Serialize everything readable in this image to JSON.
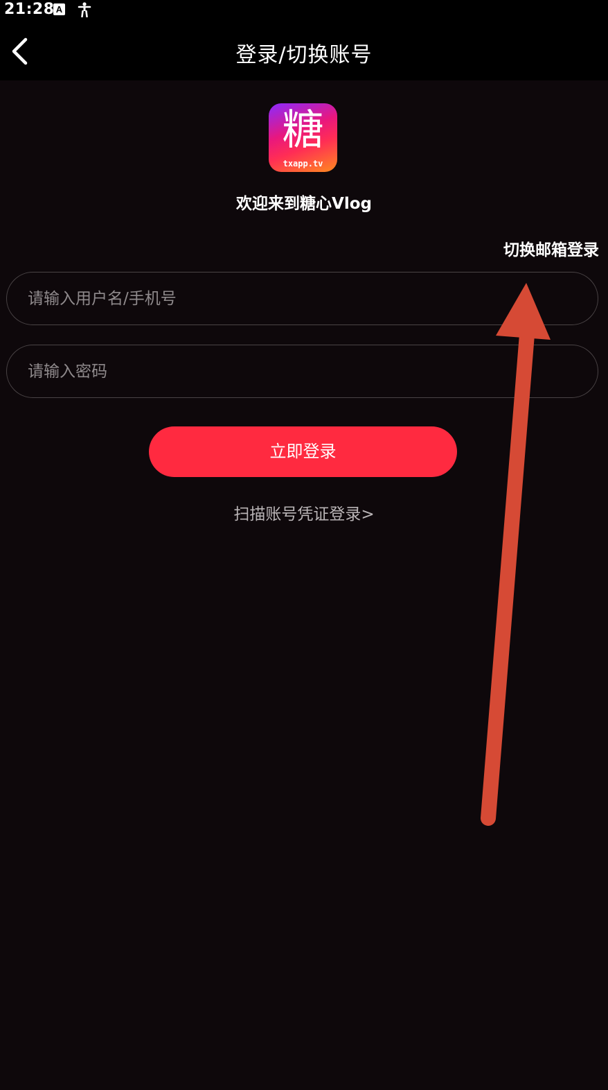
{
  "status_bar": {
    "time": "21:28",
    "icons": [
      "a-notification-icon",
      "accessibility-icon"
    ]
  },
  "header": {
    "title": "登录/切换账号",
    "back_icon": "chevron-left-icon"
  },
  "logo": {
    "char": "糖",
    "url": "txapp.tv"
  },
  "welcome": "欢迎来到糖心Vlog",
  "switch_email": "切换邮箱登录",
  "form": {
    "username_placeholder": "请输入用户名/手机号",
    "password_placeholder": "请输入密码",
    "login_button": "立即登录",
    "scan_login": "扫描账号凭证登录>"
  },
  "colors": {
    "background": "#0e080b",
    "accent": "#ff2a40",
    "annotation_arrow": "#d64a35"
  }
}
